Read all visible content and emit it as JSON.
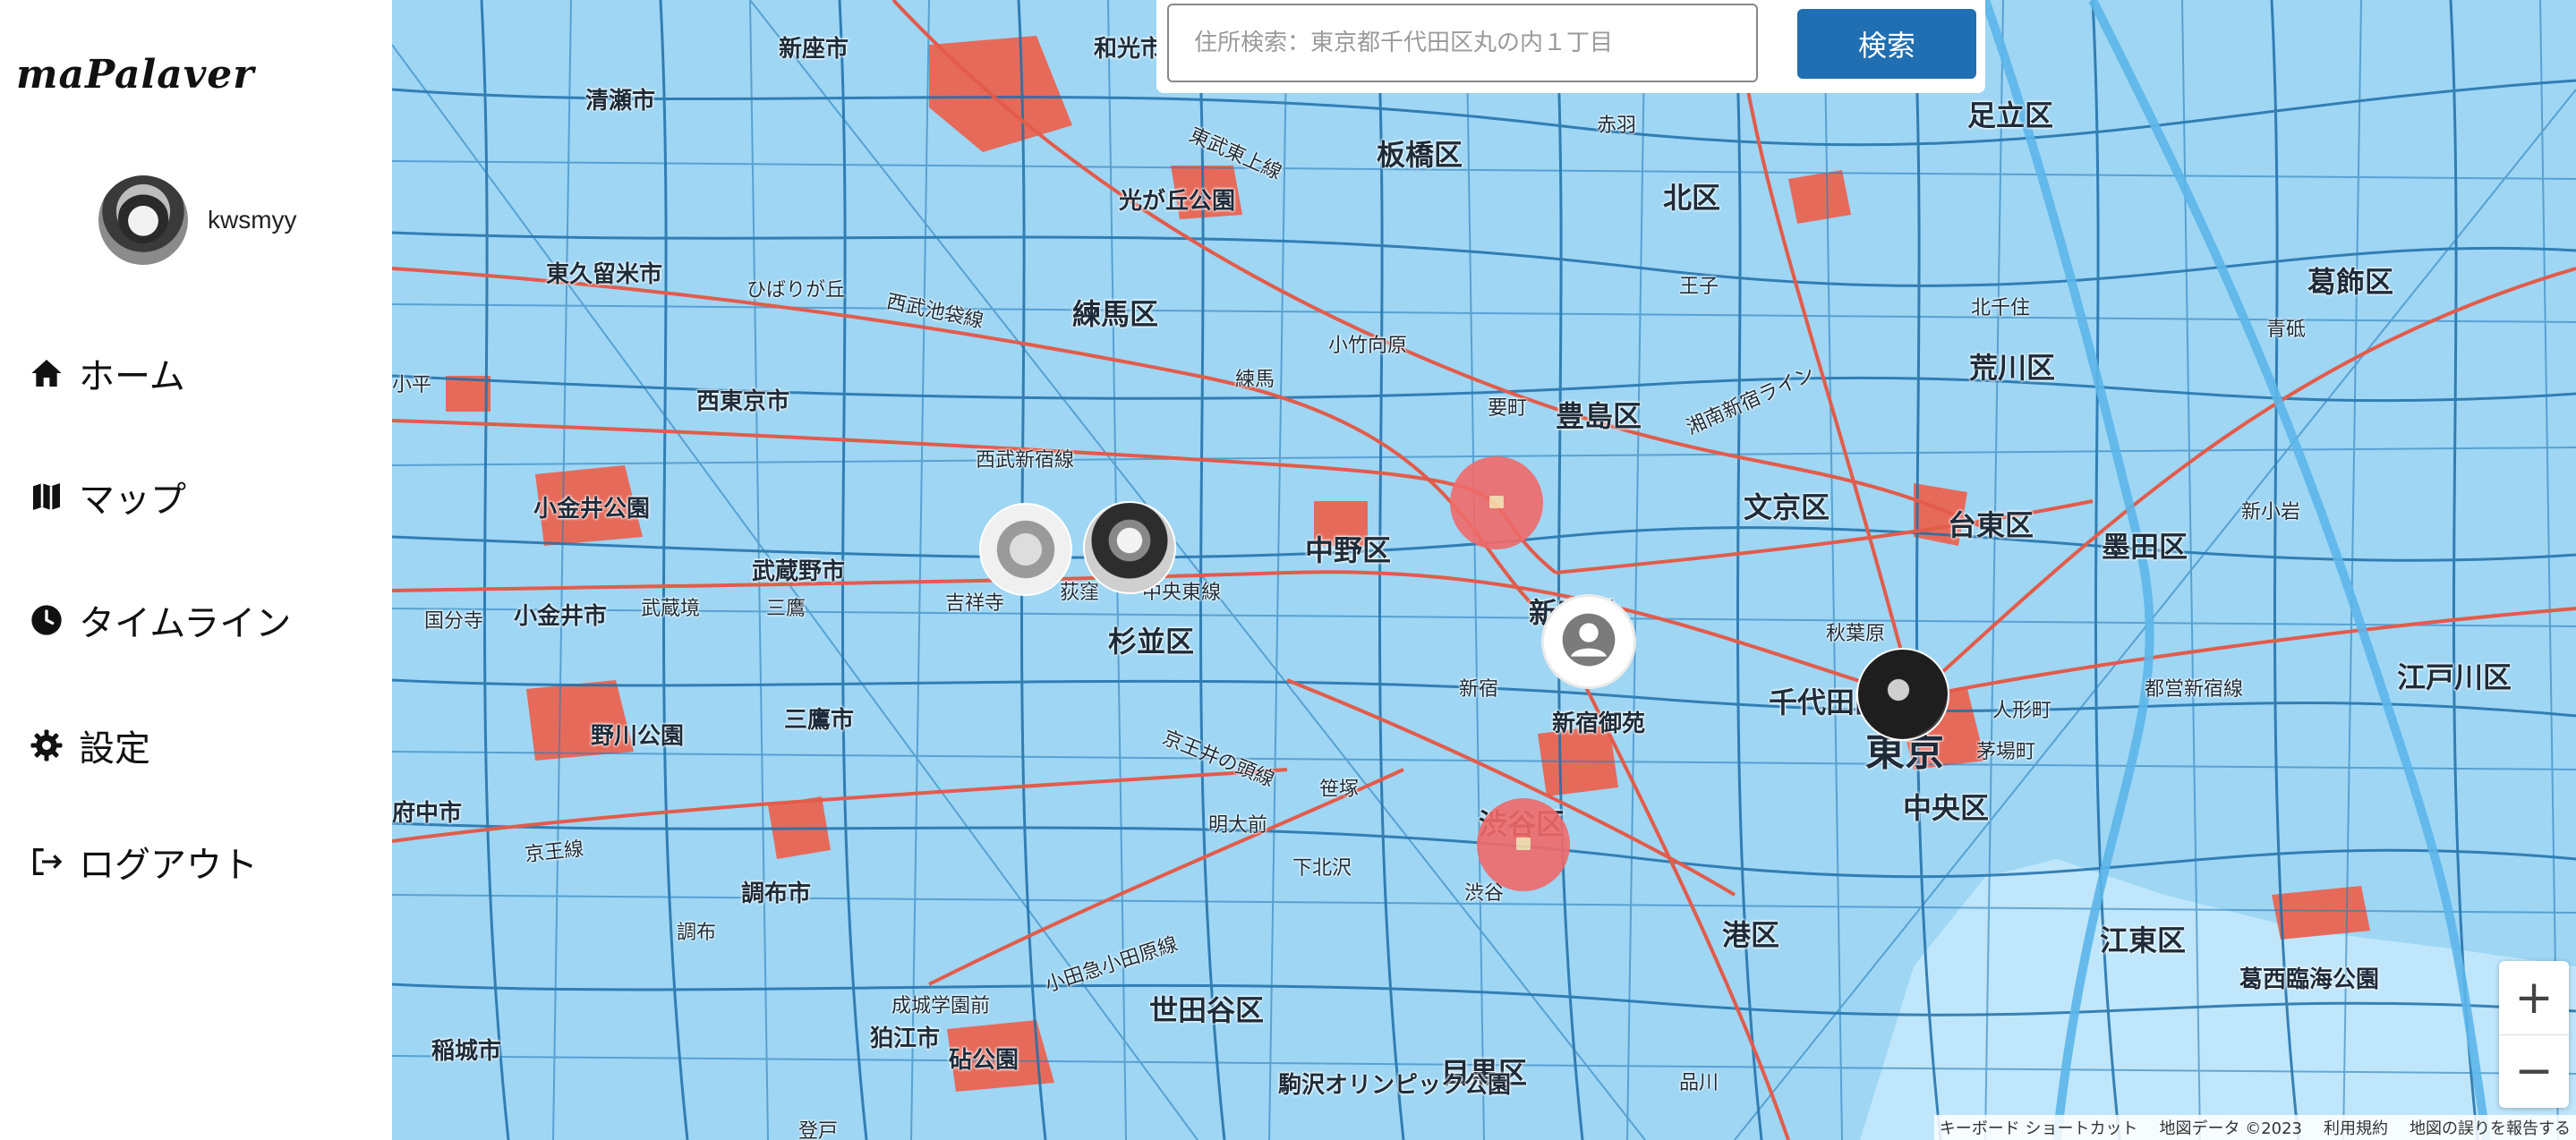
{
  "app": {
    "title": "maPalaver"
  },
  "profile": {
    "username": "kwsmyy"
  },
  "nav": [
    {
      "label": "ホーム",
      "icon": "home-icon"
    },
    {
      "label": "マップ",
      "icon": "map-icon"
    },
    {
      "label": "タイムライン",
      "icon": "clock-icon"
    },
    {
      "label": "設定",
      "icon": "gear-icon"
    },
    {
      "label": "ログアウト",
      "icon": "logout-icon"
    }
  ],
  "search": {
    "placeholder": "住所検索：東京都千代田区丸の内１丁目",
    "button_label": "検索"
  },
  "map": {
    "labels": {
      "shinjuku_ward": "新宿区",
      "toshima": "豊島区",
      "kita": "北区",
      "itabashi": "板橋区",
      "nerima": "練馬区",
      "nakano": "中野区",
      "suginami": "杉並区",
      "bunkyo": "文京区",
      "taito": "台東区",
      "sumida": "墨田区",
      "arakawa": "荒川区",
      "adachi": "足立区",
      "katsushika": "葛飾区",
      "edogawa": "江戸川区",
      "chiyoda": "千代田区",
      "chuo": "中央区",
      "minato": "港区",
      "koto": "江東区",
      "setagaya": "世田谷区",
      "meguro": "目黒区",
      "shibuya_ward": "渋谷区",
      "tokyo": "東京",
      "musashino": "武蔵野市",
      "mitaka": "三鷹市",
      "koganei": "小金井市",
      "chofu": "調布市",
      "komae": "狛江市",
      "inagi": "稲城市",
      "fuchu": "府中市",
      "nishitokyo": "西東京市",
      "higashikurume": "東久留米市",
      "kiyose": "清瀬市",
      "niiza": "新座市",
      "wako": "和光市",
      "koganei_park": "小金井公園",
      "nogawa_park": "野川公園",
      "hikarigaoka_park": "光が丘公園",
      "shinjuku_gyoen": "新宿御苑",
      "kichijoji": "吉祥寺",
      "ogikubo": "荻窪",
      "shinjuku_st": "新宿",
      "shibuya_st": "渋谷",
      "shimokitazawa": "下北沢",
      "meidaimae": "明大前",
      "sasazuka": "笹塚",
      "akihabara": "秋葉原",
      "ningyocho": "人形町",
      "kayabacho": "茅場町",
      "shinagawa": "品川",
      "kita_senju": "北千住",
      "ikebukuro_area": "要町",
      "nerima_st": "練馬",
      "kotake": "小竹向原",
      "oji": "王子",
      "akabane": "赤羽",
      "aoto": "青砥",
      "shin_koiwa": "新小岩",
      "kasai_park": "葛西臨海公園",
      "chuo_sobu": "中央東線",
      "seibu_shinjuku": "西武新宿線",
      "seibu_ikebukuro": "西武池袋線",
      "keio": "京王井の頭線",
      "odakyu": "小田急小田原線",
      "shonan_shinjuku": "湘南新宿ライン",
      "toei_shinjuku": "都営新宿線",
      "tobu_tojo": "東武東上線",
      "hibarigaoka": "ひばりが丘",
      "seijogakuen": "成城学園前",
      "kinuta": "砧公園",
      "komazawa": "駒沢オリンピック公園",
      "noborito": "登戸",
      "kodaira": "小平",
      "kokubunji": "国分寺",
      "musashisakai": "武蔵境",
      "mitaka_st": "三鷹",
      "keio_line": "京王線",
      "chofu_st": "調布"
    }
  },
  "zoom": {
    "in_label": "+",
    "out_label": "−"
  },
  "attribution": {
    "shortcuts": "キーボード ショートカット",
    "data": "地図データ ©2023",
    "terms": "利用規約",
    "report": "地図の誤りを報告する"
  }
}
